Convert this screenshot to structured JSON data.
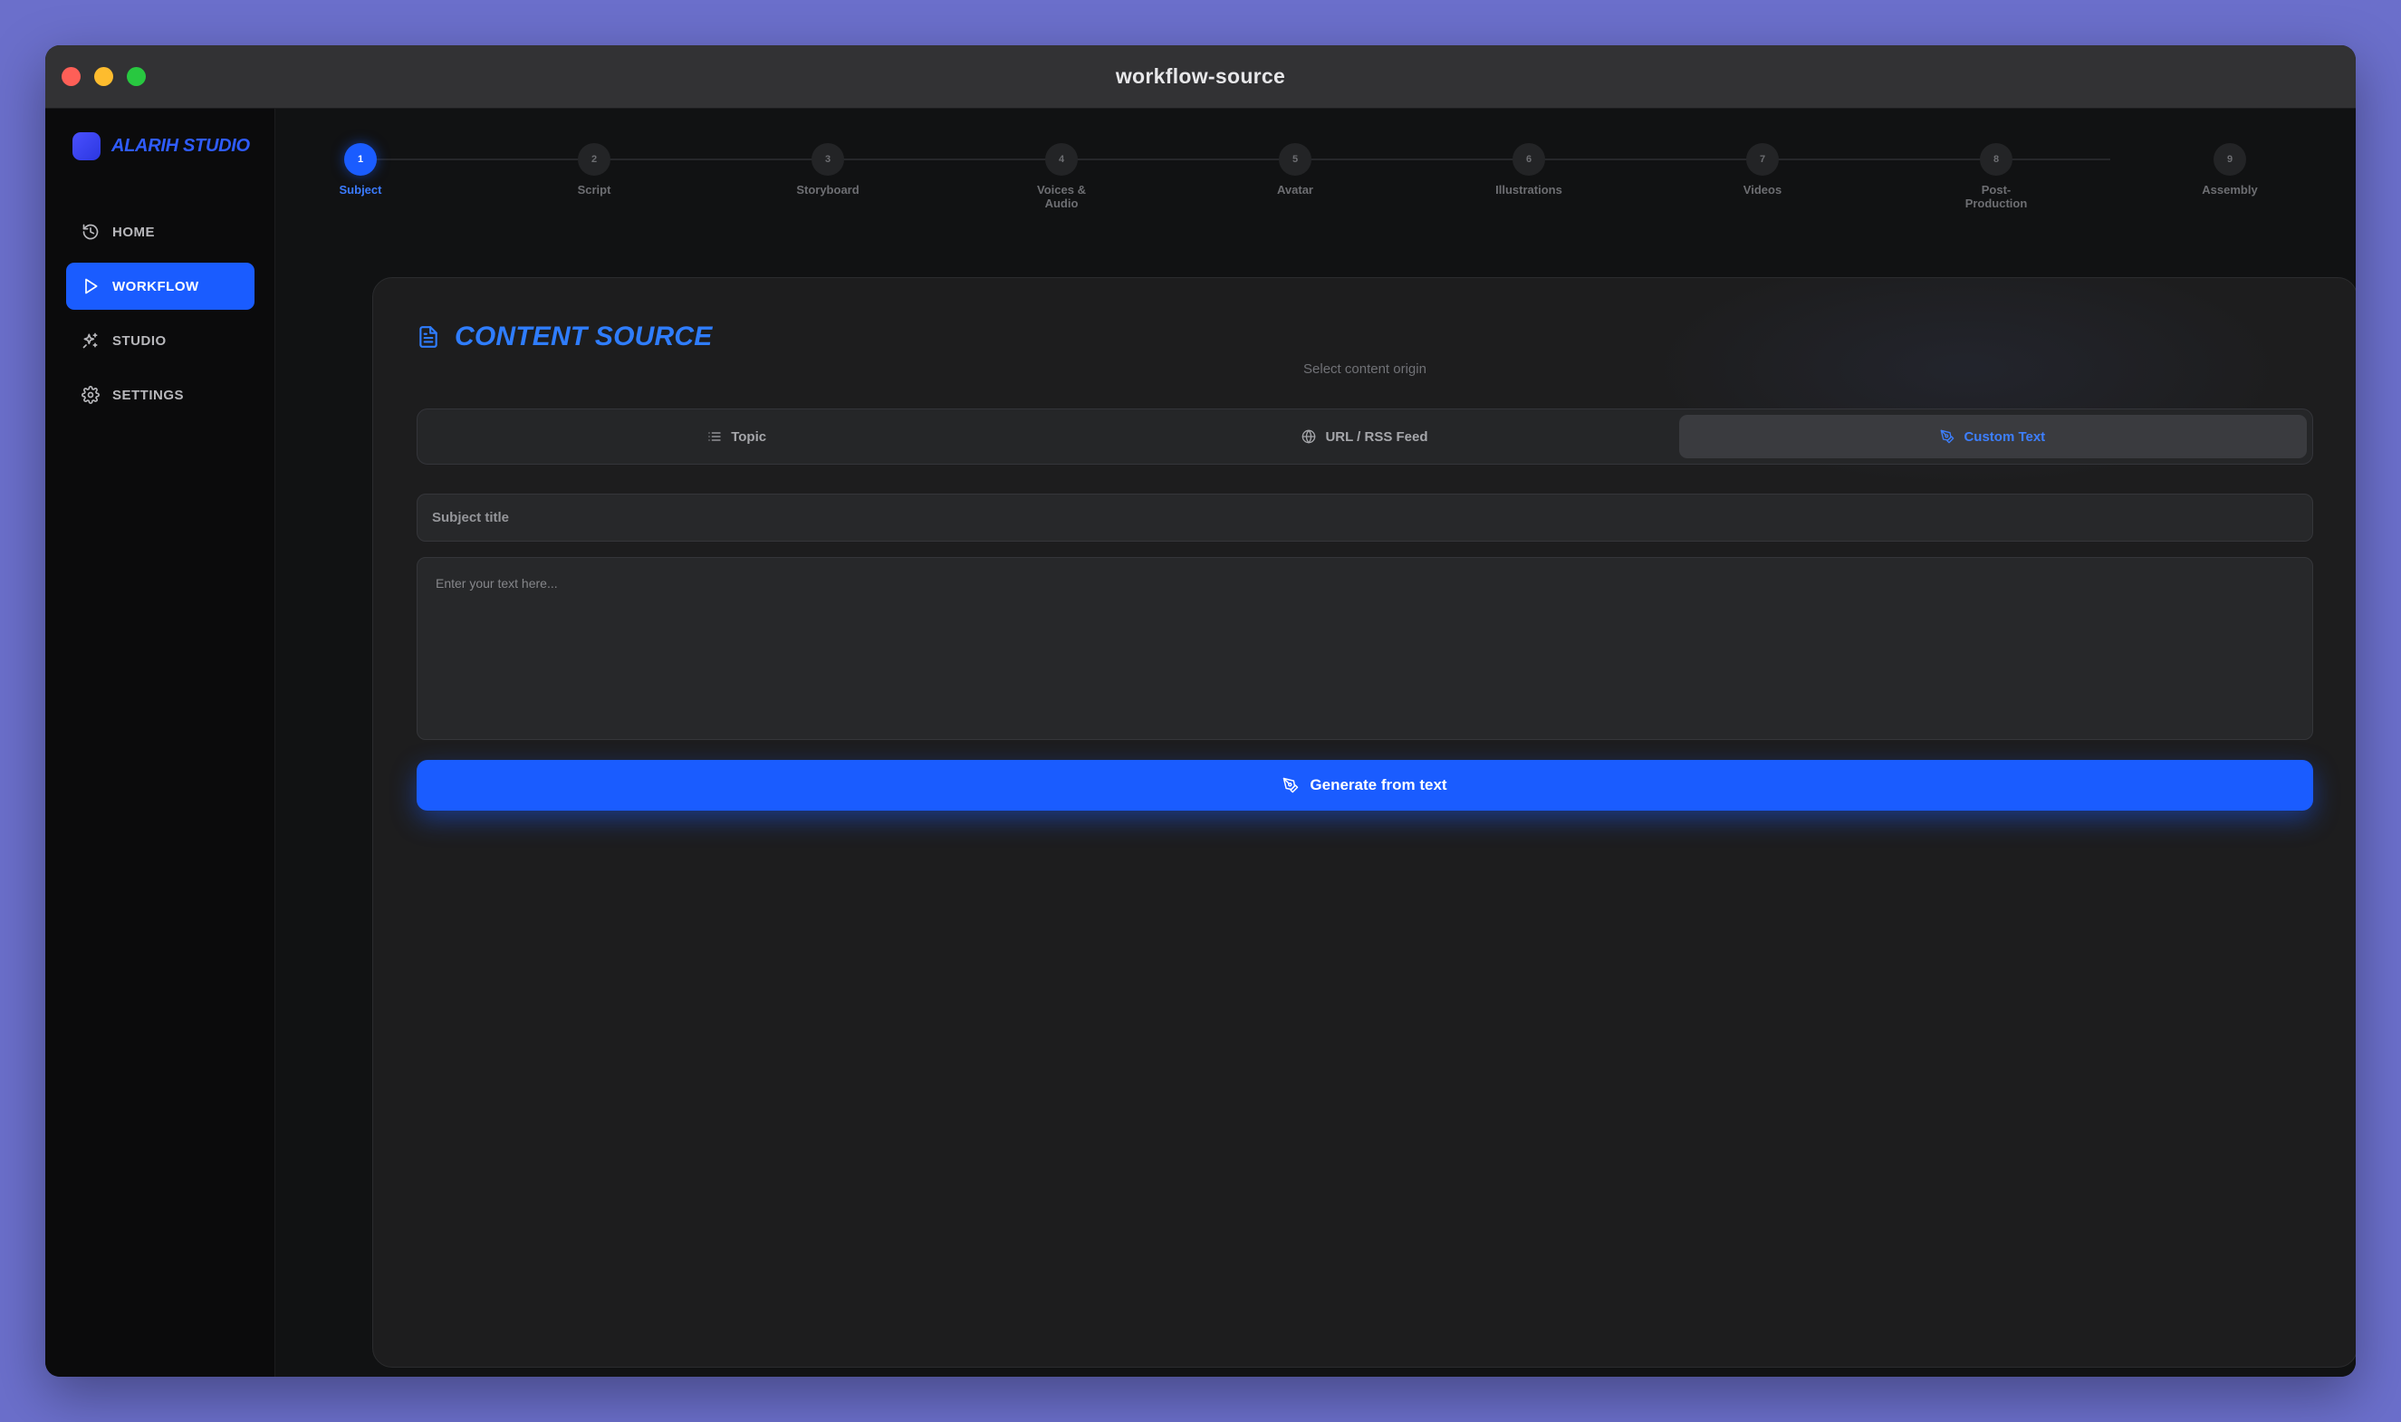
{
  "window": {
    "title": "workflow-source"
  },
  "brand": {
    "name": "ALARIH STUDIO"
  },
  "sidebar": {
    "items": [
      {
        "label": "HOME",
        "icon": "history-icon",
        "active": false
      },
      {
        "label": "WORKFLOW",
        "icon": "play-icon",
        "active": true
      },
      {
        "label": "STUDIO",
        "icon": "sparkles-icon",
        "active": false
      },
      {
        "label": "SETTINGS",
        "icon": "gear-icon",
        "active": false
      }
    ]
  },
  "stepper": {
    "steps": [
      {
        "number": "1",
        "label": "Subject",
        "active": true
      },
      {
        "number": "2",
        "label": "Script",
        "active": false
      },
      {
        "number": "3",
        "label": "Storyboard",
        "active": false
      },
      {
        "number": "4",
        "label": "Voices & Audio",
        "active": false
      },
      {
        "number": "5",
        "label": "Avatar",
        "active": false
      },
      {
        "number": "6",
        "label": "Illustrations",
        "active": false
      },
      {
        "number": "7",
        "label": "Videos",
        "active": false
      },
      {
        "number": "8",
        "label": "Post-Production",
        "active": false
      },
      {
        "number": "9",
        "label": "Assembly",
        "active": false
      }
    ]
  },
  "content": {
    "title": "CONTENT SOURCE",
    "subtitle": "Select content origin",
    "tabs": [
      {
        "label": "Topic",
        "icon": "list-icon",
        "active": false
      },
      {
        "label": "URL / RSS Feed",
        "icon": "globe-icon",
        "active": false
      },
      {
        "label": "Custom Text",
        "icon": "pen-tool-icon",
        "active": true
      }
    ],
    "subject_placeholder": "Subject title",
    "text_placeholder": "Enter your text here...",
    "generate_label": "Generate from text"
  },
  "colors": {
    "accent": "#1a5cff",
    "accent_text": "#2f7dff"
  }
}
